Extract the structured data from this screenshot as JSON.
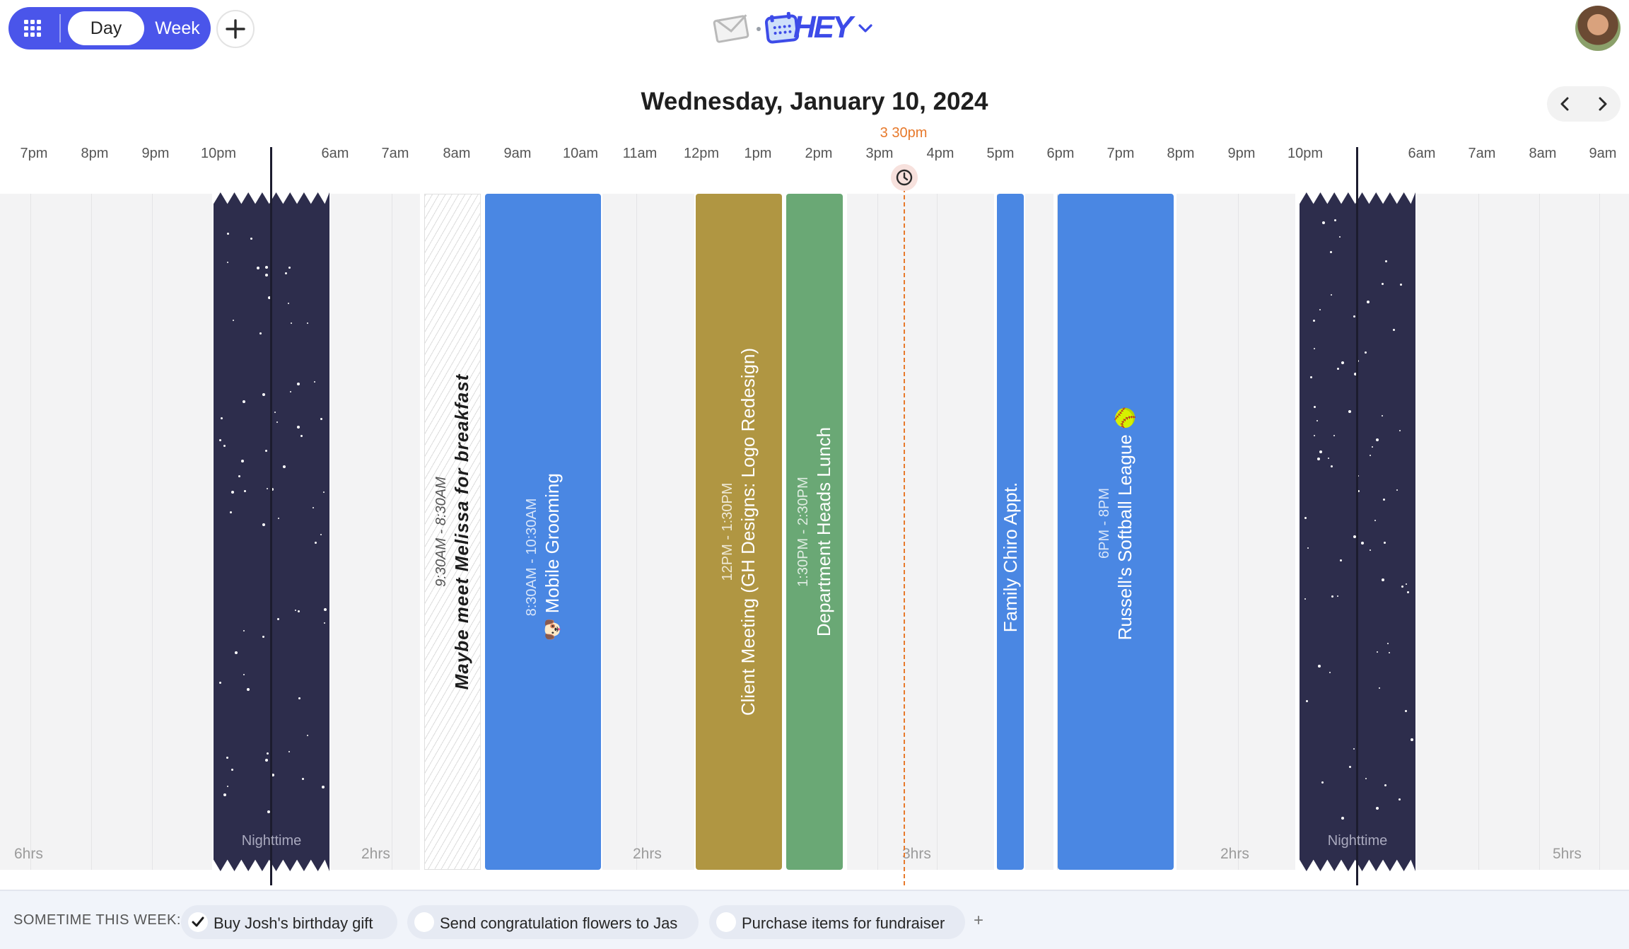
{
  "header": {
    "view_day": "Day",
    "view_week": "Week",
    "logo_text": "HEY",
    "date_title": "Wednesday, January 10, 2024"
  },
  "timeline": {
    "hours": [
      "7pm",
      "8pm",
      "9pm",
      "10pm",
      "6am",
      "7am",
      "8am",
      "9am",
      "10am",
      "11am",
      "12pm",
      "1pm",
      "2pm",
      "3pm",
      "4pm",
      "5pm",
      "6pm",
      "7pm",
      "8pm",
      "9pm",
      "10pm",
      "6am",
      "7am",
      "8am",
      "9am"
    ],
    "now_label": "3 30pm",
    "night_label": "Nighttime",
    "durations": [
      "6hrs",
      "2hrs",
      "2hrs",
      "3hrs",
      "2hrs",
      "5hrs"
    ]
  },
  "events": {
    "maybe_breakfast": {
      "time": "9:30AM - 8:30AM",
      "title": "Maybe meet Melissa for breakfast"
    },
    "mobile_grooming": {
      "time": "8:30AM - 10:30AM",
      "title": "Mobile Grooming",
      "emoji": "🐶"
    },
    "client_meeting": {
      "time": "12PM - 1:30PM",
      "title": "Client Meeting (GH Designs: Logo Redesign)"
    },
    "dept_lunch": {
      "time": "1:30PM - 2:30PM",
      "title": "Department Heads Lunch"
    },
    "chiro": {
      "title": "Family Chiro Appt."
    },
    "softball": {
      "time": "6PM - 8PM",
      "title": "Russell's Softball League",
      "emoji": "🥎"
    }
  },
  "colors": {
    "accent": "#4a55ea",
    "event_blue": "#4a87e3",
    "event_gold": "#b09642",
    "event_green": "#6aa875",
    "night": "#2d2d4c",
    "now": "#e7792b"
  },
  "sometime": {
    "label": "SOMETIME THIS WEEK:",
    "items": [
      {
        "label": "Buy Josh's birthday gift",
        "checked": true
      },
      {
        "label": "Send congratulation flowers to Jas",
        "checked": false
      },
      {
        "label": "Purchase items for fundraiser",
        "checked": false
      }
    ],
    "add": "+"
  }
}
